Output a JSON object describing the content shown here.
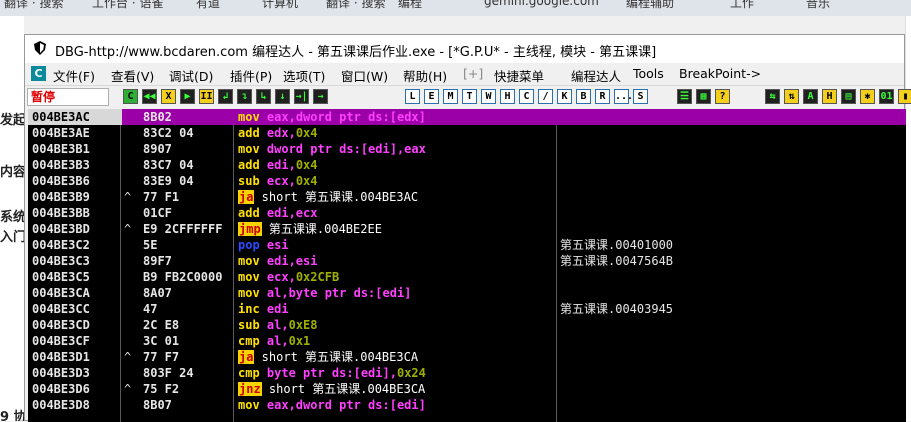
{
  "background": {
    "top_tabs": [
      "翻译 · 搜索",
      "工作台 · 语雀",
      "有道",
      "计算机",
      "翻译 · 搜索",
      "编程",
      "gemini.google.com",
      "编程辅助",
      "工作",
      "音乐"
    ],
    "left_snippets": [
      "发起",
      "内容",
      "系统",
      "入门",
      "9 协"
    ]
  },
  "window": {
    "title": "DBG-http://www.bcdaren.com 编程达人 - 第五课课后作业.exe - [*G.P.U* -  主线程, 模块 - 第五课课]"
  },
  "menu": {
    "logo": "C",
    "items": [
      "文件(F)",
      "查看(V)",
      "调试(D)",
      "插件(P)",
      "选项(T)",
      "窗口(W)",
      "帮助(H)",
      "[+]",
      "快捷菜单",
      "编程达人",
      "Tools",
      "BreakPoint->"
    ]
  },
  "toolbar": {
    "status_text": "暂停",
    "group1": [
      "C",
      "◀◀",
      "X",
      "▶",
      "II",
      "↲",
      "↴",
      "↳",
      "↓",
      "→|",
      "→"
    ],
    "group2": [
      "L",
      "E",
      "M",
      "T",
      "W",
      "H",
      "C",
      "/",
      "K",
      "B",
      "R",
      "...",
      "S"
    ],
    "group3": [
      "☰",
      "▦",
      "?"
    ],
    "group4": [
      "⇆",
      "⇅",
      "A",
      "H",
      "▤",
      "✱",
      "01",
      "▮"
    ]
  },
  "disasm": {
    "rows": [
      {
        "addr": "004BE3AC",
        "arrow": "",
        "bytes": "8B02",
        "asm": [
          {
            "t": "mov",
            "c": "mn"
          },
          {
            "t": " eax",
            "c": "op-reg"
          },
          {
            "t": ",dword ptr ds:[edx]",
            "c": "op-reg"
          }
        ],
        "comment": "",
        "selected": true
      },
      {
        "addr": "004BE3AE",
        "arrow": "",
        "bytes": "83C2 04",
        "asm": [
          {
            "t": "add",
            "c": "mn"
          },
          {
            "t": " edx",
            "c": "op-reg"
          },
          {
            "t": ",",
            "c": "op-reg"
          },
          {
            "t": "0x4",
            "c": "op-imm"
          }
        ],
        "comment": ""
      },
      {
        "addr": "004BE3B1",
        "arrow": "",
        "bytes": "8907",
        "asm": [
          {
            "t": "mov",
            "c": "mn"
          },
          {
            "t": " dword ptr ds:[edi],eax",
            "c": "op-reg"
          }
        ],
        "comment": ""
      },
      {
        "addr": "004BE3B3",
        "arrow": "",
        "bytes": "83C7 04",
        "asm": [
          {
            "t": "add",
            "c": "mn"
          },
          {
            "t": " edi",
            "c": "op-reg"
          },
          {
            "t": ",",
            "c": "op-reg"
          },
          {
            "t": "0x4",
            "c": "op-imm"
          }
        ],
        "comment": ""
      },
      {
        "addr": "004BE3B6",
        "arrow": "",
        "bytes": "83E9 04",
        "asm": [
          {
            "t": "sub",
            "c": "mn"
          },
          {
            "t": " ecx",
            "c": "op-reg"
          },
          {
            "t": ",",
            "c": "op-reg"
          },
          {
            "t": "0x4",
            "c": "op-imm"
          }
        ],
        "comment": ""
      },
      {
        "addr": "004BE3B9",
        "arrow": "^",
        "bytes": "77 F1",
        "asm": [
          {
            "t": "ja",
            "c": "mn-hl"
          },
          {
            "t": " short 第五课课.004BE3AC",
            "c": "op-sym"
          }
        ],
        "comment": ""
      },
      {
        "addr": "004BE3BB",
        "arrow": "",
        "bytes": "01CF",
        "asm": [
          {
            "t": "add",
            "c": "mn"
          },
          {
            "t": " edi,ecx",
            "c": "op-reg"
          }
        ],
        "comment": ""
      },
      {
        "addr": "004BE3BD",
        "arrow": "^",
        "bytes": "E9 2CFFFFFF",
        "asm": [
          {
            "t": "jmp",
            "c": "mn-hl"
          },
          {
            "t": " 第五课课.004BE2EE",
            "c": "op-sym"
          }
        ],
        "comment": ""
      },
      {
        "addr": "004BE3C2",
        "arrow": "",
        "bytes": "5E",
        "asm": [
          {
            "t": "pop",
            "c": "mn-pop"
          },
          {
            "t": " esi",
            "c": "op-reg"
          }
        ],
        "comment": "第五课课.00401000"
      },
      {
        "addr": "004BE3C3",
        "arrow": "",
        "bytes": "89F7",
        "asm": [
          {
            "t": "mov",
            "c": "mn"
          },
          {
            "t": " edi,esi",
            "c": "op-reg"
          }
        ],
        "comment": "第五课课.0047564B"
      },
      {
        "addr": "004BE3C5",
        "arrow": "",
        "bytes": "B9 FB2C0000",
        "asm": [
          {
            "t": "mov",
            "c": "mn"
          },
          {
            "t": " ecx",
            "c": "op-reg"
          },
          {
            "t": ",",
            "c": "op-reg"
          },
          {
            "t": "0x2CFB",
            "c": "op-imm"
          }
        ],
        "comment": ""
      },
      {
        "addr": "004BE3CA",
        "arrow": "",
        "bytes": "8A07",
        "asm": [
          {
            "t": "mov",
            "c": "mn"
          },
          {
            "t": " al,byte ptr ds:[edi]",
            "c": "op-reg"
          }
        ],
        "comment": ""
      },
      {
        "addr": "004BE3CC",
        "arrow": "",
        "bytes": "47",
        "asm": [
          {
            "t": "inc",
            "c": "mn"
          },
          {
            "t": " edi",
            "c": "op-reg"
          }
        ],
        "comment": "第五课课.00403945"
      },
      {
        "addr": "004BE3CD",
        "arrow": "",
        "bytes": "2C E8",
        "asm": [
          {
            "t": "sub",
            "c": "mn"
          },
          {
            "t": " al",
            "c": "op-reg"
          },
          {
            "t": ",",
            "c": "op-reg"
          },
          {
            "t": "0xE8",
            "c": "op-imm"
          }
        ],
        "comment": ""
      },
      {
        "addr": "004BE3CF",
        "arrow": "",
        "bytes": "3C 01",
        "asm": [
          {
            "t": "cmp",
            "c": "mn"
          },
          {
            "t": " al",
            "c": "op-reg"
          },
          {
            "t": ",",
            "c": "op-reg"
          },
          {
            "t": "0x1",
            "c": "op-imm"
          }
        ],
        "comment": ""
      },
      {
        "addr": "004BE3D1",
        "arrow": "^",
        "bytes": "77 F7",
        "asm": [
          {
            "t": "ja",
            "c": "mn-hl"
          },
          {
            "t": " short 第五课课.004BE3CA",
            "c": "op-sym"
          }
        ],
        "comment": ""
      },
      {
        "addr": "004BE3D3",
        "arrow": "",
        "bytes": "803F 24",
        "asm": [
          {
            "t": "cmp",
            "c": "mn"
          },
          {
            "t": " byte ptr ds:[edi]",
            "c": "op-reg"
          },
          {
            "t": ",",
            "c": "op-reg"
          },
          {
            "t": "0x24",
            "c": "op-imm"
          }
        ],
        "comment": ""
      },
      {
        "addr": "004BE3D6",
        "arrow": "^",
        "bytes": "75 F2",
        "asm": [
          {
            "t": "jnz",
            "c": "mn-hl"
          },
          {
            "t": " short 第五课课.004BE3CA",
            "c": "op-sym"
          }
        ],
        "comment": ""
      },
      {
        "addr": "004BE3D8",
        "arrow": "",
        "bytes": "8B07",
        "asm": [
          {
            "t": "mov",
            "c": "mn"
          },
          {
            "t": " eax,dword ptr ds:[edi]",
            "c": "op-reg"
          }
        ],
        "comment": ""
      }
    ]
  }
}
